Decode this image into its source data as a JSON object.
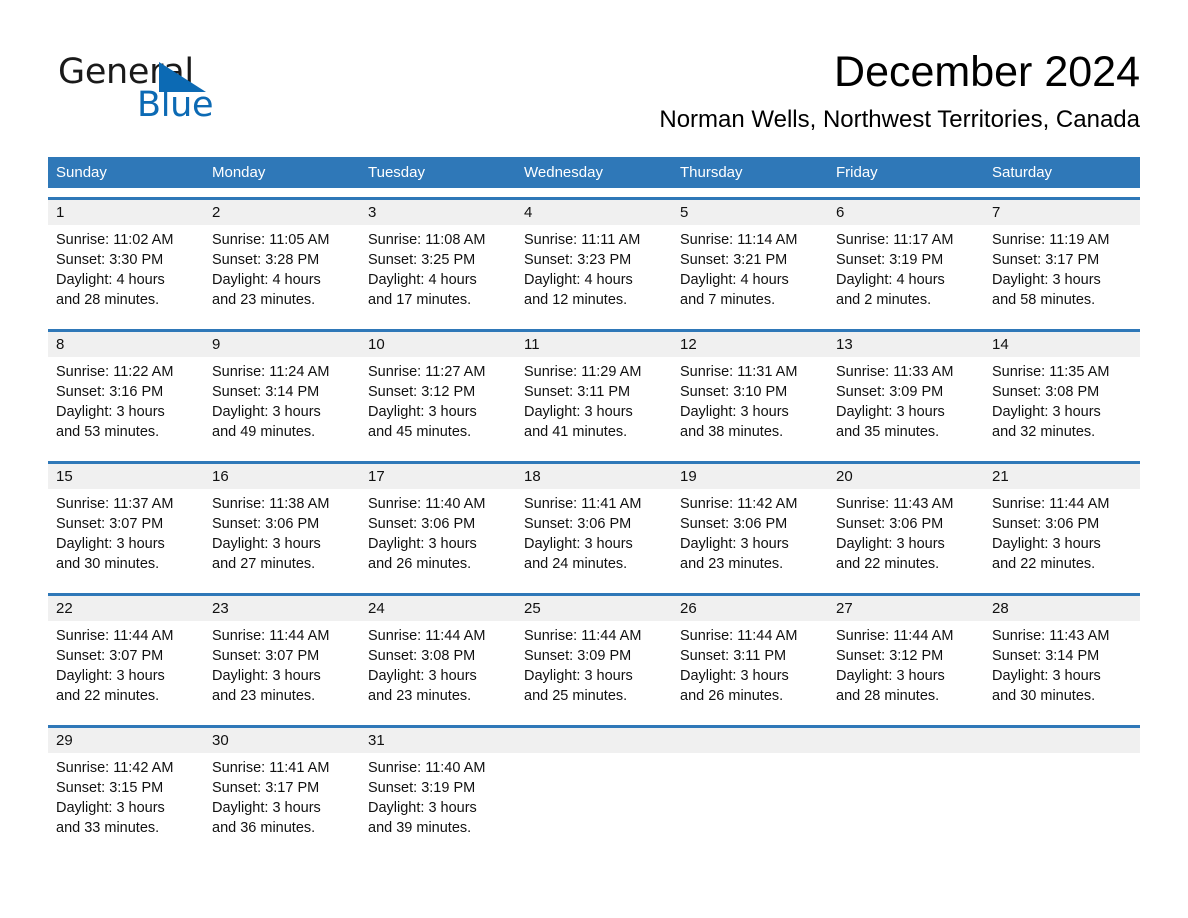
{
  "brand": {
    "name_part1": "General",
    "name_part2": "Blue",
    "triangle_icon": "triangle-icon",
    "accent_color": "#0c6ab4"
  },
  "header": {
    "month_title": "December 2024",
    "location": "Norman Wells, Northwest Territories, Canada"
  },
  "calendar": {
    "header_color": "#2f78b8",
    "daynum_band_color": "#f0f0f0",
    "weekdays": [
      "Sunday",
      "Monday",
      "Tuesday",
      "Wednesday",
      "Thursday",
      "Friday",
      "Saturday"
    ],
    "weeks": [
      {
        "days": [
          {
            "num": "1",
            "l1": "Sunrise: 11:02 AM",
            "l2": "Sunset: 3:30 PM",
            "l3": "Daylight: 4 hours",
            "l4": "and 28 minutes."
          },
          {
            "num": "2",
            "l1": "Sunrise: 11:05 AM",
            "l2": "Sunset: 3:28 PM",
            "l3": "Daylight: 4 hours",
            "l4": "and 23 minutes."
          },
          {
            "num": "3",
            "l1": "Sunrise: 11:08 AM",
            "l2": "Sunset: 3:25 PM",
            "l3": "Daylight: 4 hours",
            "l4": "and 17 minutes."
          },
          {
            "num": "4",
            "l1": "Sunrise: 11:11 AM",
            "l2": "Sunset: 3:23 PM",
            "l3": "Daylight: 4 hours",
            "l4": "and 12 minutes."
          },
          {
            "num": "5",
            "l1": "Sunrise: 11:14 AM",
            "l2": "Sunset: 3:21 PM",
            "l3": "Daylight: 4 hours",
            "l4": "and 7 minutes."
          },
          {
            "num": "6",
            "l1": "Sunrise: 11:17 AM",
            "l2": "Sunset: 3:19 PM",
            "l3": "Daylight: 4 hours",
            "l4": "and 2 minutes."
          },
          {
            "num": "7",
            "l1": "Sunrise: 11:19 AM",
            "l2": "Sunset: 3:17 PM",
            "l3": "Daylight: 3 hours",
            "l4": "and 58 minutes."
          }
        ]
      },
      {
        "days": [
          {
            "num": "8",
            "l1": "Sunrise: 11:22 AM",
            "l2": "Sunset: 3:16 PM",
            "l3": "Daylight: 3 hours",
            "l4": "and 53 minutes."
          },
          {
            "num": "9",
            "l1": "Sunrise: 11:24 AM",
            "l2": "Sunset: 3:14 PM",
            "l3": "Daylight: 3 hours",
            "l4": "and 49 minutes."
          },
          {
            "num": "10",
            "l1": "Sunrise: 11:27 AM",
            "l2": "Sunset: 3:12 PM",
            "l3": "Daylight: 3 hours",
            "l4": "and 45 minutes."
          },
          {
            "num": "11",
            "l1": "Sunrise: 11:29 AM",
            "l2": "Sunset: 3:11 PM",
            "l3": "Daylight: 3 hours",
            "l4": "and 41 minutes."
          },
          {
            "num": "12",
            "l1": "Sunrise: 11:31 AM",
            "l2": "Sunset: 3:10 PM",
            "l3": "Daylight: 3 hours",
            "l4": "and 38 minutes."
          },
          {
            "num": "13",
            "l1": "Sunrise: 11:33 AM",
            "l2": "Sunset: 3:09 PM",
            "l3": "Daylight: 3 hours",
            "l4": "and 35 minutes."
          },
          {
            "num": "14",
            "l1": "Sunrise: 11:35 AM",
            "l2": "Sunset: 3:08 PM",
            "l3": "Daylight: 3 hours",
            "l4": "and 32 minutes."
          }
        ]
      },
      {
        "days": [
          {
            "num": "15",
            "l1": "Sunrise: 11:37 AM",
            "l2": "Sunset: 3:07 PM",
            "l3": "Daylight: 3 hours",
            "l4": "and 30 minutes."
          },
          {
            "num": "16",
            "l1": "Sunrise: 11:38 AM",
            "l2": "Sunset: 3:06 PM",
            "l3": "Daylight: 3 hours",
            "l4": "and 27 minutes."
          },
          {
            "num": "17",
            "l1": "Sunrise: 11:40 AM",
            "l2": "Sunset: 3:06 PM",
            "l3": "Daylight: 3 hours",
            "l4": "and 26 minutes."
          },
          {
            "num": "18",
            "l1": "Sunrise: 11:41 AM",
            "l2": "Sunset: 3:06 PM",
            "l3": "Daylight: 3 hours",
            "l4": "and 24 minutes."
          },
          {
            "num": "19",
            "l1": "Sunrise: 11:42 AM",
            "l2": "Sunset: 3:06 PM",
            "l3": "Daylight: 3 hours",
            "l4": "and 23 minutes."
          },
          {
            "num": "20",
            "l1": "Sunrise: 11:43 AM",
            "l2": "Sunset: 3:06 PM",
            "l3": "Daylight: 3 hours",
            "l4": "and 22 minutes."
          },
          {
            "num": "21",
            "l1": "Sunrise: 11:44 AM",
            "l2": "Sunset: 3:06 PM",
            "l3": "Daylight: 3 hours",
            "l4": "and 22 minutes."
          }
        ]
      },
      {
        "days": [
          {
            "num": "22",
            "l1": "Sunrise: 11:44 AM",
            "l2": "Sunset: 3:07 PM",
            "l3": "Daylight: 3 hours",
            "l4": "and 22 minutes."
          },
          {
            "num": "23",
            "l1": "Sunrise: 11:44 AM",
            "l2": "Sunset: 3:07 PM",
            "l3": "Daylight: 3 hours",
            "l4": "and 23 minutes."
          },
          {
            "num": "24",
            "l1": "Sunrise: 11:44 AM",
            "l2": "Sunset: 3:08 PM",
            "l3": "Daylight: 3 hours",
            "l4": "and 23 minutes."
          },
          {
            "num": "25",
            "l1": "Sunrise: 11:44 AM",
            "l2": "Sunset: 3:09 PM",
            "l3": "Daylight: 3 hours",
            "l4": "and 25 minutes."
          },
          {
            "num": "26",
            "l1": "Sunrise: 11:44 AM",
            "l2": "Sunset: 3:11 PM",
            "l3": "Daylight: 3 hours",
            "l4": "and 26 minutes."
          },
          {
            "num": "27",
            "l1": "Sunrise: 11:44 AM",
            "l2": "Sunset: 3:12 PM",
            "l3": "Daylight: 3 hours",
            "l4": "and 28 minutes."
          },
          {
            "num": "28",
            "l1": "Sunrise: 11:43 AM",
            "l2": "Sunset: 3:14 PM",
            "l3": "Daylight: 3 hours",
            "l4": "and 30 minutes."
          }
        ]
      },
      {
        "days": [
          {
            "num": "29",
            "l1": "Sunrise: 11:42 AM",
            "l2": "Sunset: 3:15 PM",
            "l3": "Daylight: 3 hours",
            "l4": "and 33 minutes."
          },
          {
            "num": "30",
            "l1": "Sunrise: 11:41 AM",
            "l2": "Sunset: 3:17 PM",
            "l3": "Daylight: 3 hours",
            "l4": "and 36 minutes."
          },
          {
            "num": "31",
            "l1": "Sunrise: 11:40 AM",
            "l2": "Sunset: 3:19 PM",
            "l3": "Daylight: 3 hours",
            "l4": "and 39 minutes."
          },
          {
            "num": "",
            "l1": "",
            "l2": "",
            "l3": "",
            "l4": ""
          },
          {
            "num": "",
            "l1": "",
            "l2": "",
            "l3": "",
            "l4": ""
          },
          {
            "num": "",
            "l1": "",
            "l2": "",
            "l3": "",
            "l4": ""
          },
          {
            "num": "",
            "l1": "",
            "l2": "",
            "l3": "",
            "l4": ""
          }
        ]
      }
    ]
  }
}
